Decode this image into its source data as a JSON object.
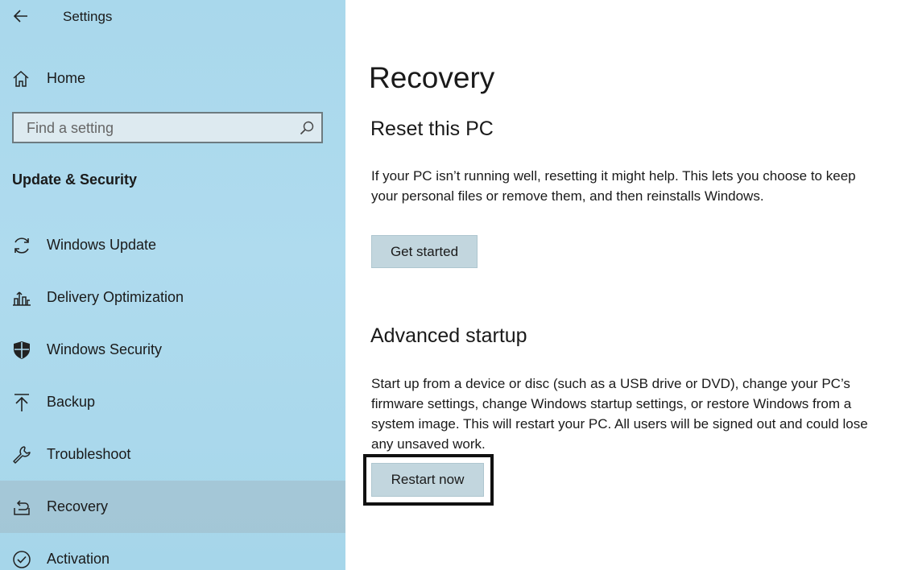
{
  "window": {
    "title": "Settings"
  },
  "colors": {
    "sidebar_bg": "#a9d8ec",
    "button_bg": "#c2d6de",
    "selected_item_bg": "#a0b4be",
    "highlight_frame": "#111111"
  },
  "sidebar": {
    "back_icon": "back-arrow-icon",
    "home_label": "Home",
    "search": {
      "placeholder": "Find a setting",
      "value": ""
    },
    "section_title": "Update & Security",
    "items": [
      {
        "label": "Windows Update",
        "icon": "sync-icon",
        "selected": false
      },
      {
        "label": "Delivery Optimization",
        "icon": "delivery-optimization-icon",
        "selected": false
      },
      {
        "label": "Windows Security",
        "icon": "shield-icon",
        "selected": false
      },
      {
        "label": "Backup",
        "icon": "upload-arrow-icon",
        "selected": false
      },
      {
        "label": "Troubleshoot",
        "icon": "wrench-icon",
        "selected": false
      },
      {
        "label": "Recovery",
        "icon": "recovery-icon",
        "selected": true
      },
      {
        "label": "Activation",
        "icon": "check-circle-icon",
        "selected": false
      }
    ]
  },
  "main": {
    "title": "Recovery",
    "reset": {
      "heading": "Reset this PC",
      "description": "If your PC isn’t running well, resetting it might help. This lets you choose to keep your personal files or remove them, and then reinstalls Windows.",
      "button_label": "Get started"
    },
    "advanced": {
      "heading": "Advanced startup",
      "description": "Start up from a device or disc (such as a USB drive or DVD), change your PC’s firmware settings, change Windows startup settings, or restore Windows from a system image. This will restart your PC. All users will be signed out and could lose any unsaved work.",
      "button_label": "Restart now"
    }
  }
}
